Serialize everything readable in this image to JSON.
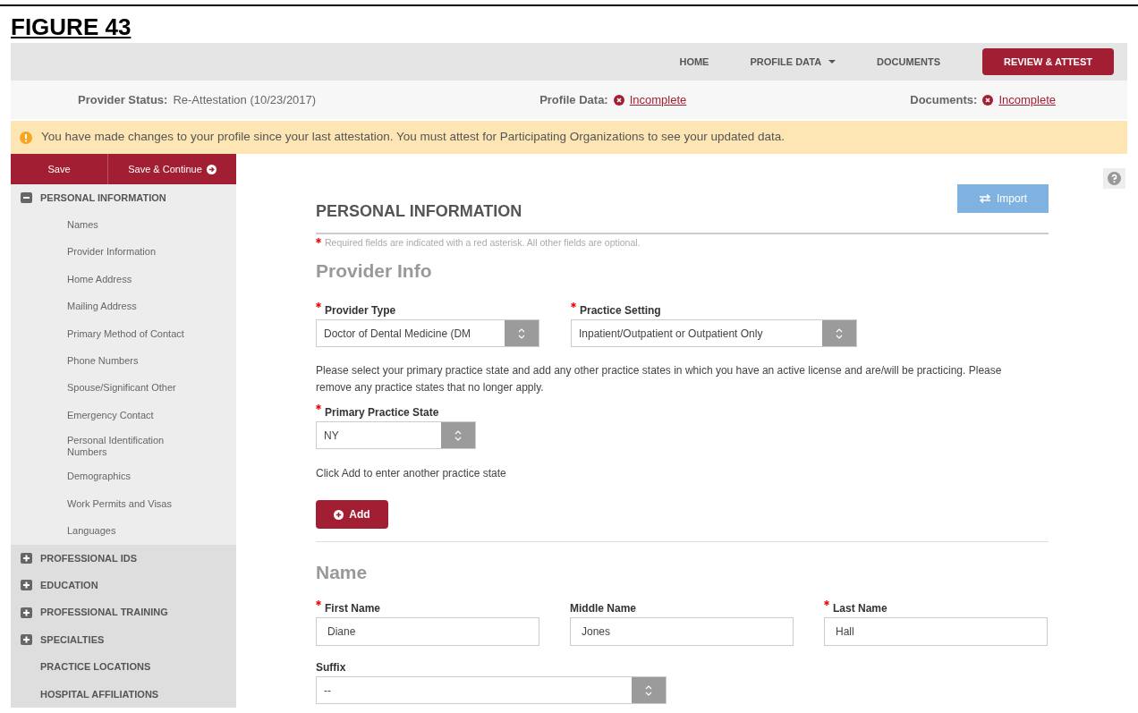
{
  "figure_caption": "FIGURE 43",
  "nav": [
    {
      "label": "HOME",
      "kind": "link"
    },
    {
      "label": "PROFILE DATA",
      "kind": "dropdown"
    },
    {
      "label": "DOCUMENTS",
      "kind": "link"
    },
    {
      "label": "REVIEW & ATTEST",
      "kind": "primary"
    }
  ],
  "status": [
    {
      "label": "Provider Status:",
      "value": "Re-Attestation (10/23/2017)",
      "kind": "plain"
    },
    {
      "label": "Profile Data:",
      "value": "Incomplete",
      "kind": "incomplete"
    },
    {
      "label": "Documents:",
      "value": "Incomplete",
      "kind": "incomplete"
    }
  ],
  "alert": "You have made changes to your profile since your last attestation. You must attest for Participating Organizations to see your updated data.",
  "sidebar": {
    "save": "Save",
    "save_continue": "Save & Continue",
    "sections": [
      {
        "label": "PERSONAL INFORMATION",
        "kind": "group",
        "expanded": true,
        "children": [
          {
            "label": "Names"
          },
          {
            "label": "Provider Information"
          },
          {
            "label": "Home Address"
          },
          {
            "label": "Mailing Address"
          },
          {
            "label": "Primary Method of Contact"
          },
          {
            "label": "Phone Numbers"
          },
          {
            "label": "Spouse/Significant Other"
          },
          {
            "label": "Emergency Contact"
          },
          {
            "label": "Personal Identification Numbers"
          },
          {
            "label": "Demographics"
          },
          {
            "label": "Work Permits and Visas"
          },
          {
            "label": "Languages"
          }
        ]
      },
      {
        "label": "PROFESSIONAL IDS",
        "kind": "group",
        "expanded": false
      },
      {
        "label": "EDUCATION",
        "kind": "group",
        "expanded": false
      },
      {
        "label": "PROFESSIONAL TRAINING",
        "kind": "group",
        "expanded": false
      },
      {
        "label": "SPECIALTIES",
        "kind": "group",
        "expanded": false
      },
      {
        "label": "PRACTICE LOCATIONS",
        "kind": "link"
      },
      {
        "label": "HOSPITAL AFFILIATIONS",
        "kind": "link"
      }
    ]
  },
  "form": {
    "title": "PERSONAL INFORMATION",
    "import": "Import",
    "required_note": "Required fields are indicated with a red asterisk. All other fields are optional.",
    "provider_info": {
      "heading": "Provider Info",
      "fields": [
        {
          "label": "Provider Type",
          "required": true,
          "kind": "select",
          "value": "Doctor of Dental Medicine (DM"
        },
        {
          "label": "Practice Setting",
          "required": true,
          "kind": "select",
          "value": "Inpatient/Outpatient or Outpatient Only"
        }
      ],
      "instructions": "Please select your primary practice state and add any other practice states in which you have an active license and are/will be practicing. Please remove any practice states that no longer apply.",
      "state_field": {
        "label": "Primary Practice State",
        "required": true,
        "kind": "select",
        "value": "NY"
      },
      "add_hint": "Click Add to enter another practice state",
      "add_button": "Add"
    },
    "name": {
      "heading": "Name",
      "fields": [
        {
          "label": "First Name",
          "required": true,
          "kind": "text",
          "value": "Diane"
        },
        {
          "label": "Middle Name",
          "required": false,
          "kind": "text",
          "value": "Jones"
        },
        {
          "label": "Last Name",
          "required": true,
          "kind": "text",
          "value": "Hall"
        }
      ],
      "suffix": {
        "label": "Suffix",
        "required": false,
        "kind": "select",
        "value": "--"
      }
    }
  }
}
